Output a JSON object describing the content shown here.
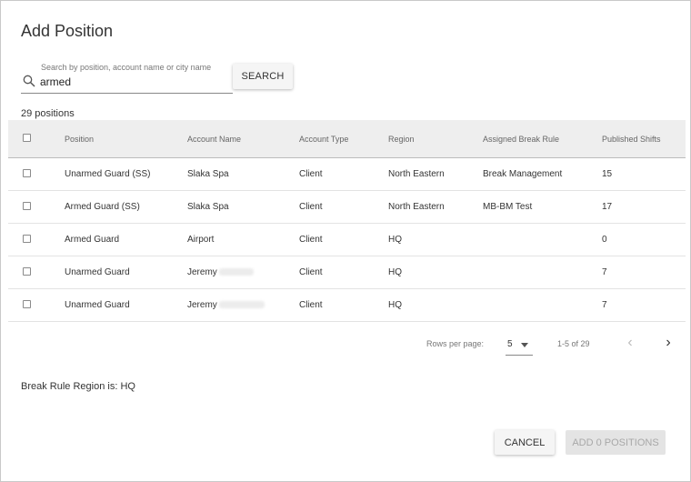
{
  "dialog": {
    "title": "Add Position"
  },
  "search": {
    "hint": "Search by position, account name or city name",
    "value": "armed",
    "button_label": "SEARCH"
  },
  "results": {
    "count_label": "29 positions"
  },
  "table": {
    "columns": [
      "Position",
      "Account Name",
      "Account Type",
      "Region",
      "Assigned Break Rule",
      "Published Shifts"
    ],
    "rows": [
      {
        "position": "Unarmed Guard (SS)",
        "account": "Slaka Spa",
        "account_redacted": false,
        "type": "Client",
        "region": "North Eastern",
        "break_rule": "Break Management",
        "shifts": "15"
      },
      {
        "position": "Armed Guard (SS)",
        "account": "Slaka Spa",
        "account_redacted": false,
        "type": "Client",
        "region": "North Eastern",
        "break_rule": "MB-BM Test",
        "shifts": "17"
      },
      {
        "position": "Armed Guard",
        "account": "Airport",
        "account_redacted": false,
        "type": "Client",
        "region": "HQ",
        "break_rule": "",
        "shifts": "0"
      },
      {
        "position": "Unarmed Guard",
        "account": "Jeremy",
        "account_redacted": true,
        "type": "Client",
        "region": "HQ",
        "break_rule": "",
        "shifts": "7"
      },
      {
        "position": "Unarmed Guard",
        "account": "Jeremy",
        "account_redacted": true,
        "type": "Client",
        "region": "HQ",
        "break_rule": "",
        "shifts": "7"
      }
    ]
  },
  "pagination": {
    "rows_per_page_label": "Rows per page:",
    "rows_per_page_value": "5",
    "range_label": "1-5 of 29",
    "prev_icon": "chevron-left",
    "next_icon": "chevron-right"
  },
  "footer": {
    "rule_note": "Break Rule Region is: HQ",
    "cancel_label": "CANCEL",
    "add_label": "ADD 0 POSITIONS"
  }
}
